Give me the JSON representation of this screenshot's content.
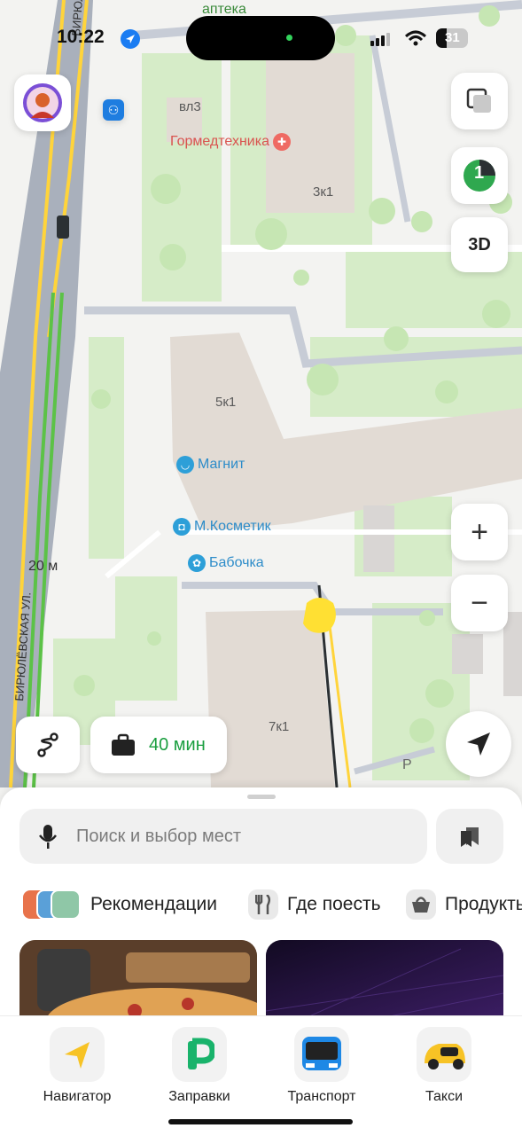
{
  "status_bar": {
    "time": "10:22",
    "battery": "31"
  },
  "map": {
    "street_labels": [
      "аптека",
      "БИРЮЛЁ",
      "БИРЮЛЁВСКАЯ УЛ.",
      "20 м",
      "P"
    ],
    "buildings": [
      "вл3",
      "3к1",
      "5к1",
      "7к1"
    ],
    "pois": [
      {
        "name": "Гормедтехника",
        "kind": "medical"
      },
      {
        "name": "Магнит",
        "kind": "shop"
      },
      {
        "name": "М.Косметик",
        "kind": "shop"
      },
      {
        "name": "Бабочка",
        "kind": "shop"
      }
    ]
  },
  "controls": {
    "layers_icon": "layers-icon",
    "traffic_badge": "1",
    "three_d_label": "3D",
    "zoom_in": "+",
    "zoom_out": "−",
    "commute_label": "40 мин"
  },
  "sheet": {
    "search_placeholder": "Поиск и выбор мест",
    "chips": [
      "Рекомендации",
      "Где поесть",
      "Продукты"
    ]
  },
  "tabs": [
    {
      "label": "Навигатор",
      "icon": "navigator-icon"
    },
    {
      "label": "Заправки",
      "icon": "fuel-icon"
    },
    {
      "label": "Транспорт",
      "icon": "bus-icon"
    },
    {
      "label": "Такси",
      "icon": "taxi-icon"
    }
  ],
  "colors": {
    "accent_green": "#1a9e3f",
    "map_green": "#d6ecc8",
    "building": "#e2dbd4"
  }
}
